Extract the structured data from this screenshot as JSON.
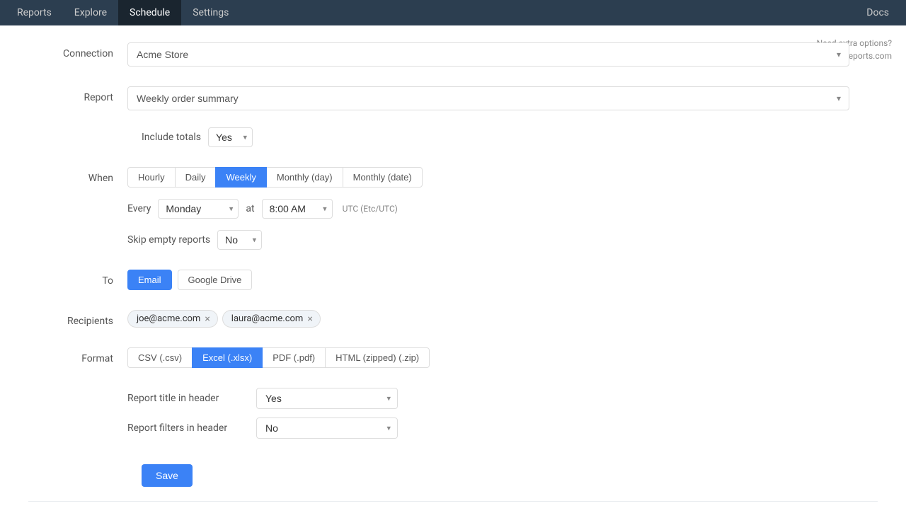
{
  "nav": {
    "items": [
      {
        "label": "Reports",
        "active": false
      },
      {
        "label": "Explore",
        "active": false
      },
      {
        "label": "Schedule",
        "active": true
      },
      {
        "label": "Settings",
        "active": false
      }
    ],
    "docs_label": "Docs"
  },
  "help": {
    "line1": "Need extra options?",
    "line2": "Let us know at hello@betterreports.com"
  },
  "form": {
    "connection_label": "Connection",
    "connection_value": "Acme Store",
    "report_label": "Report",
    "report_value": "Weekly order summary",
    "include_totals_label": "Include totals",
    "include_totals_value": "Yes",
    "when_label": "When",
    "when_tabs": [
      "Hourly",
      "Daily",
      "Weekly",
      "Monthly (day)",
      "Monthly (date)"
    ],
    "when_active": "Weekly",
    "every_label": "Every",
    "every_value": "Monday",
    "at_label": "at",
    "time_value": "8:00 AM",
    "utc_label": "UTC (Etc/UTC)",
    "skip_label": "Skip empty reports",
    "skip_value": "No",
    "to_label": "To",
    "to_tabs": [
      "Email",
      "Google Drive"
    ],
    "to_active": "Email",
    "recipients_label": "Recipients",
    "recipients": [
      {
        "email": "joe@acme.com"
      },
      {
        "email": "laura@acme.com"
      }
    ],
    "format_label": "Format",
    "format_tabs": [
      "CSV (.csv)",
      "Excel (.xlsx)",
      "PDF (.pdf)",
      "HTML (zipped) (.zip)"
    ],
    "format_active": "Excel (.xlsx)",
    "report_title_label": "Report title in header",
    "report_title_value": "Yes",
    "report_filters_label": "Report filters in header",
    "report_filters_value": "No",
    "save_label": "Save"
  }
}
